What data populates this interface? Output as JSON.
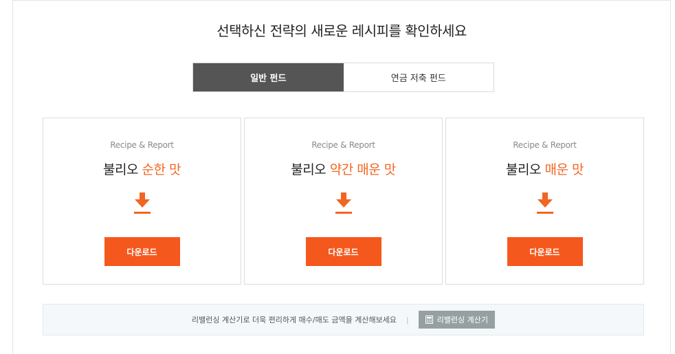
{
  "page_title": "선택하신 전략의 새로운 레시피를 확인하세요",
  "tabs": [
    {
      "label": "일반 펀드",
      "active": true
    },
    {
      "label": "연금 저축 펀드",
      "active": false
    }
  ],
  "cards": [
    {
      "subtitle": "Recipe & Report",
      "title_prefix": "불리오 ",
      "title_accent": "순한 맛",
      "button_label": "다운로드"
    },
    {
      "subtitle": "Recipe & Report",
      "title_prefix": "불리오 ",
      "title_accent": "약간 매운 맛",
      "button_label": "다운로드"
    },
    {
      "subtitle": "Recipe & Report",
      "title_prefix": "불리오 ",
      "title_accent": "매운 맛",
      "button_label": "다운로드"
    }
  ],
  "calculator": {
    "prompt": "리밸런싱 계산기로 더욱 편리하게 매수/매도 금액을 계산해보세요",
    "divider": "|",
    "button_label": "리밸런싱 계산기"
  },
  "colors": {
    "accent": "#f26522",
    "button": "#f4581c",
    "tab_active": "#555555",
    "calc_button": "#96a0a3"
  },
  "icons": {
    "download": "download-arrow-icon",
    "calculator": "calculator-icon"
  }
}
